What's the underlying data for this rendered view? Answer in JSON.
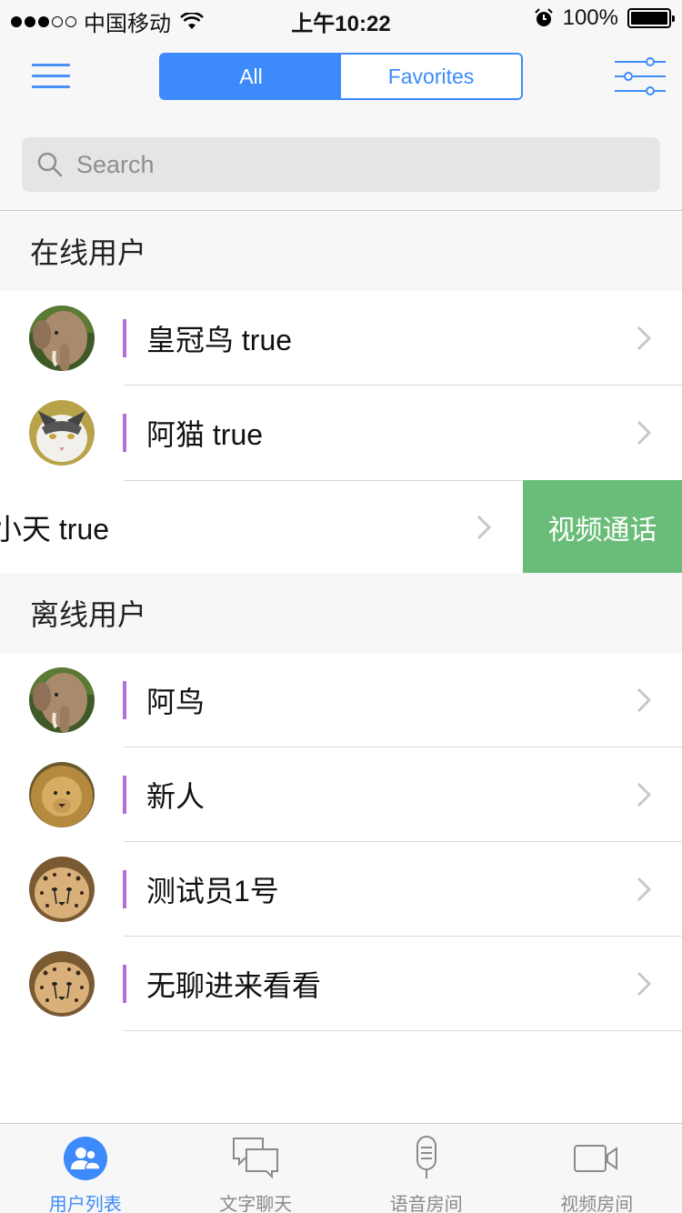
{
  "status_bar": {
    "carrier": "中国移动",
    "time": "上午10:22",
    "battery": "100%"
  },
  "nav": {
    "segments": [
      "All",
      "Favorites"
    ],
    "active_segment": "All"
  },
  "search": {
    "placeholder": "Search",
    "value": ""
  },
  "sections": {
    "online": {
      "title": "在线用户",
      "users": [
        {
          "name": "皇冠鸟 true",
          "avatar": "elephant-avatar"
        },
        {
          "name": "阿猫 true",
          "avatar": "cat-avatar"
        },
        {
          "name": "小天 true",
          "avatar": "hidden-avatar",
          "swiped_action": "视频通话"
        }
      ]
    },
    "offline": {
      "title": "离线用户",
      "users": [
        {
          "name": "阿鸟",
          "avatar": "elephant-avatar"
        },
        {
          "name": "新人",
          "avatar": "lion-avatar"
        },
        {
          "name": "测试员1号",
          "avatar": "cheetah-avatar"
        },
        {
          "name": "无聊进来看看",
          "avatar": "cheetah-avatar"
        }
      ]
    }
  },
  "tab_bar": {
    "tabs": [
      {
        "label": "用户列表",
        "icon": "users-icon",
        "active": true
      },
      {
        "label": "文字聊天",
        "icon": "chat-icon",
        "active": false
      },
      {
        "label": "语音房间",
        "icon": "microphone-icon",
        "active": false
      },
      {
        "label": "视频房间",
        "icon": "video-camera-icon",
        "active": false
      }
    ]
  },
  "colors": {
    "accent": "#3d8bfa",
    "row_marker": "#b36ed8",
    "swipe_action": "#6abd78"
  }
}
